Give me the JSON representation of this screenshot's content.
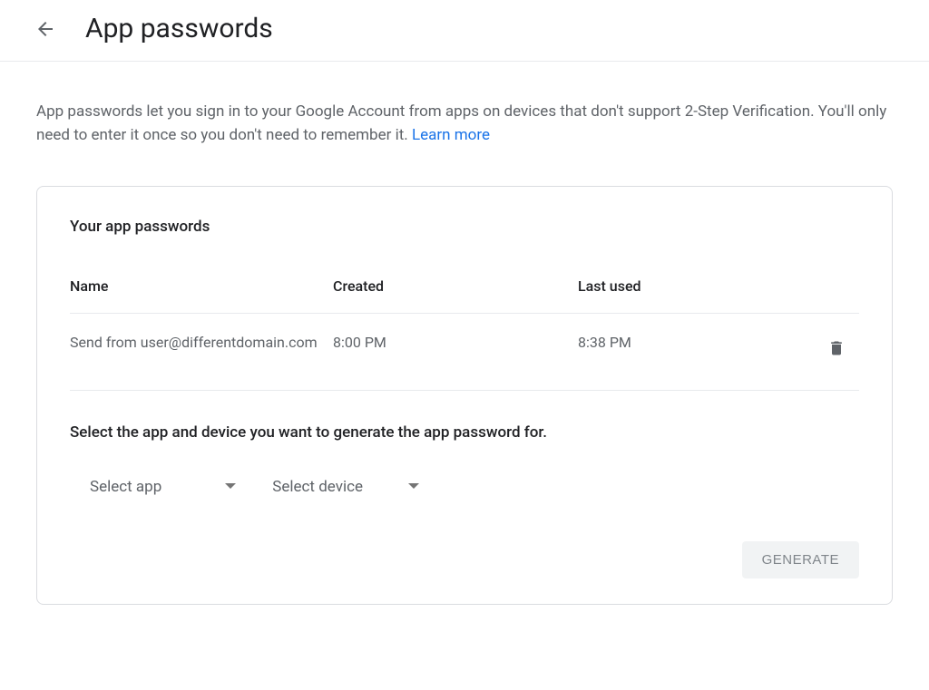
{
  "header": {
    "title": "App passwords"
  },
  "description": {
    "text": "App passwords let you sign in to your Google Account from apps on devices that don't support 2-Step Verification. You'll only need to enter it once so you don't need to remember it. ",
    "learn_more": "Learn more"
  },
  "card": {
    "heading": "Your app passwords",
    "columns": {
      "name": "Name",
      "created": "Created",
      "last_used": "Last used"
    },
    "rows": [
      {
        "name": "Send from user@differentdomain.com",
        "created": "8:00 PM",
        "last_used": "8:38 PM"
      }
    ],
    "select_prompt": "Select the app and device you want to generate the app password for.",
    "select_app": "Select app",
    "select_device": "Select device",
    "generate": "GENERATE"
  }
}
